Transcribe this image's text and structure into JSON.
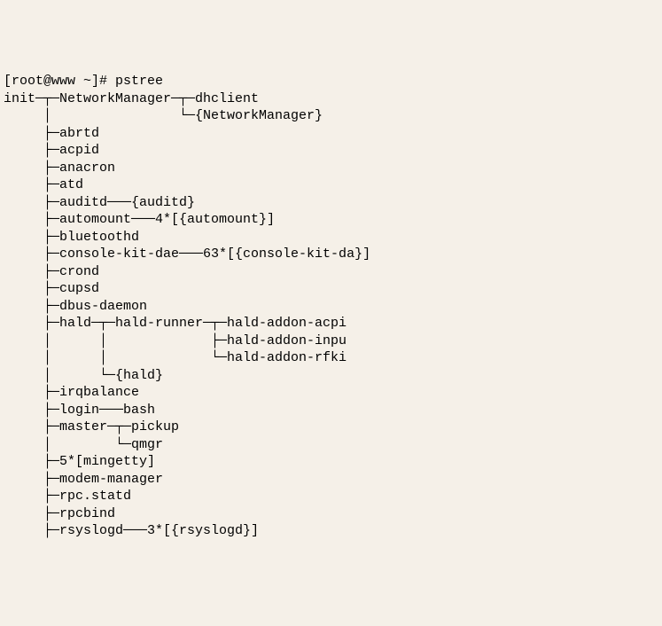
{
  "prompt": "[root@www ~]# ",
  "command": "pstree",
  "tree_lines": [
    "init─┬─NetworkManager─┬─dhclient",
    "     │                └─{NetworkManager}",
    "     ├─abrtd",
    "     ├─acpid",
    "     ├─anacron",
    "     ├─atd",
    "     ├─auditd───{auditd}",
    "     ├─automount───4*[{automount}]",
    "     ├─bluetoothd",
    "     ├─console-kit-dae───63*[{console-kit-da}]",
    "     ├─crond",
    "     ├─cupsd",
    "     ├─dbus-daemon",
    "     ├─hald─┬─hald-runner─┬─hald-addon-acpi",
    "     │      │             ├─hald-addon-inpu",
    "     │      │             └─hald-addon-rfki",
    "     │      └─{hald}",
    "     ├─irqbalance",
    "     ├─login───bash",
    "     ├─master─┬─pickup",
    "     │        └─qmgr",
    "     ├─5*[mingetty]",
    "     ├─modem-manager",
    "     ├─rpc.statd",
    "     ├─rpcbind",
    "     ├─rsyslogd───3*[{rsyslogd}]"
  ]
}
